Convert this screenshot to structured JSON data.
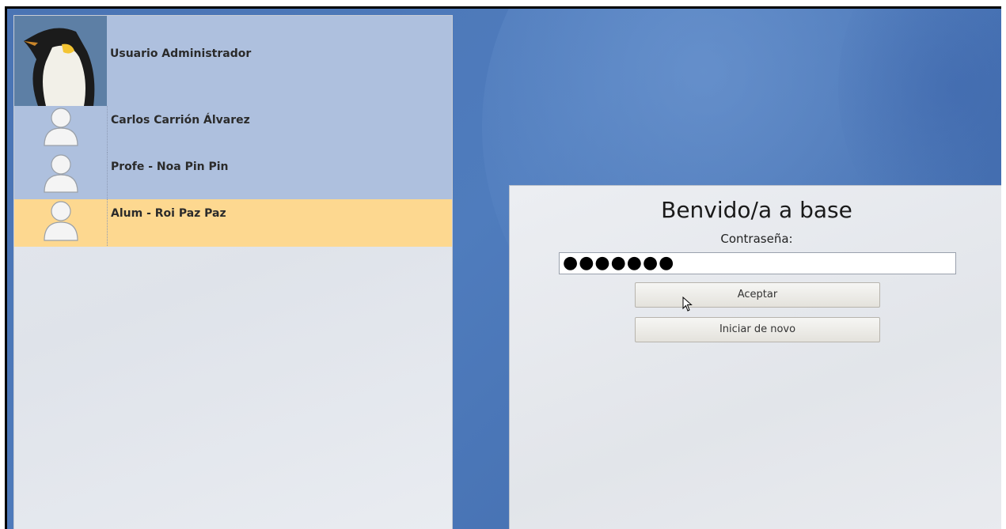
{
  "users": [
    {
      "name": "Usuario Administrador",
      "avatar": "penguin-avatar",
      "selected": false
    },
    {
      "name": "Carlos Carrión Álvarez",
      "avatar": "default-user-icon",
      "selected": false
    },
    {
      "name": "Profe - Noa Pin Pin",
      "avatar": "default-user-icon",
      "selected": false
    },
    {
      "name": "Alum - Roi Paz Paz",
      "avatar": "default-user-icon",
      "selected": true
    }
  ],
  "login": {
    "welcome": "Benvido/a a base",
    "password_label": "Contraseña:",
    "password_value": "●●●●●●●",
    "accept_label": "Aceptar",
    "restart_label": "Iniciar de novo"
  },
  "colors": {
    "row_bg": "#aec0de",
    "selected_bg": "#fdd890",
    "desktop_bg": "#4a74b4"
  }
}
